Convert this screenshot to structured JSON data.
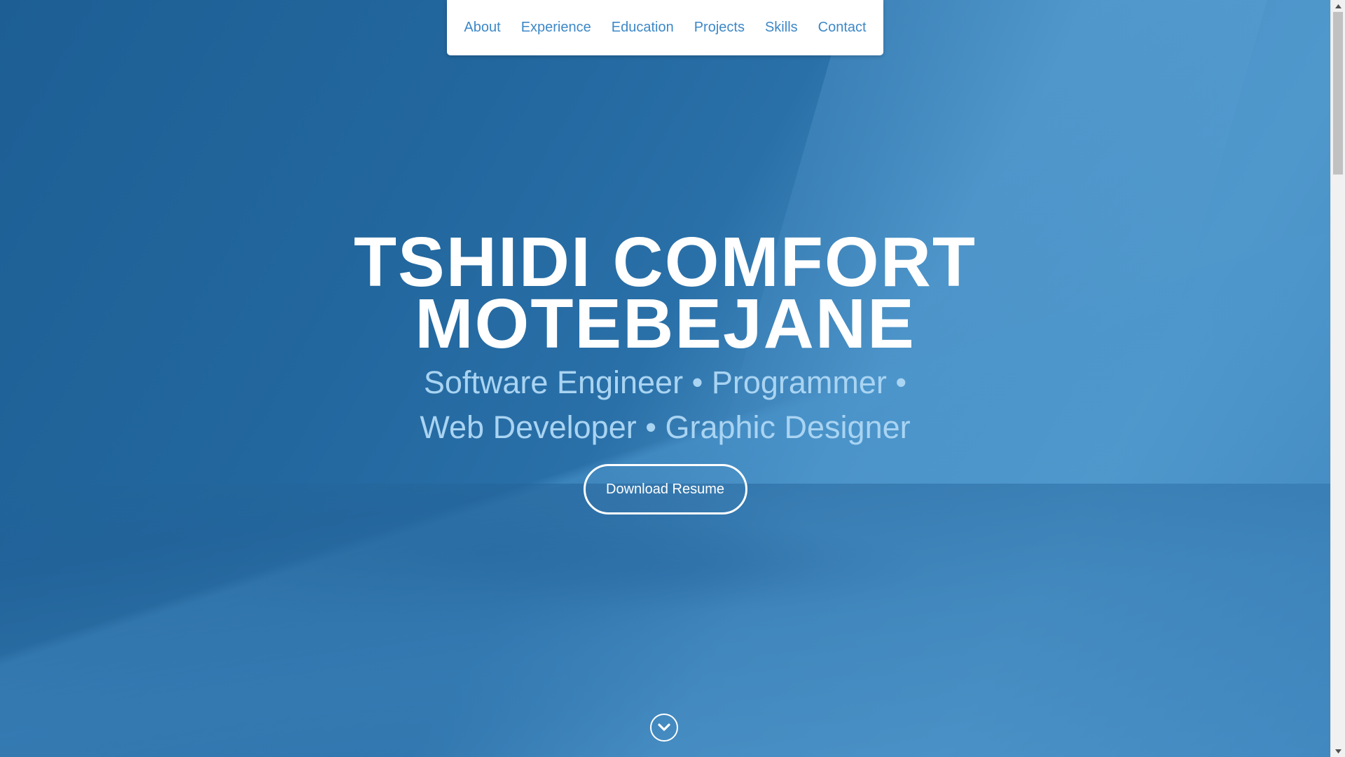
{
  "nav": {
    "items": [
      {
        "label": "About"
      },
      {
        "label": "Experience"
      },
      {
        "label": "Education"
      },
      {
        "label": "Projects"
      },
      {
        "label": "Skills"
      },
      {
        "label": "Contact"
      }
    ]
  },
  "hero": {
    "name_line1": "TSHIDI COMFORT",
    "name_line2": "MOTEBEJANE",
    "roles": "Software Engineer • Programmer • Web Developer • Graphic Designer",
    "download_label": "Download Resume"
  },
  "icons": {
    "scroll_down": "chevron-down-circle-icon"
  },
  "colors": {
    "nav_link": "#3d88c7",
    "roles_text": "#a9d4f2",
    "hero_bg": "#2a70a8"
  }
}
